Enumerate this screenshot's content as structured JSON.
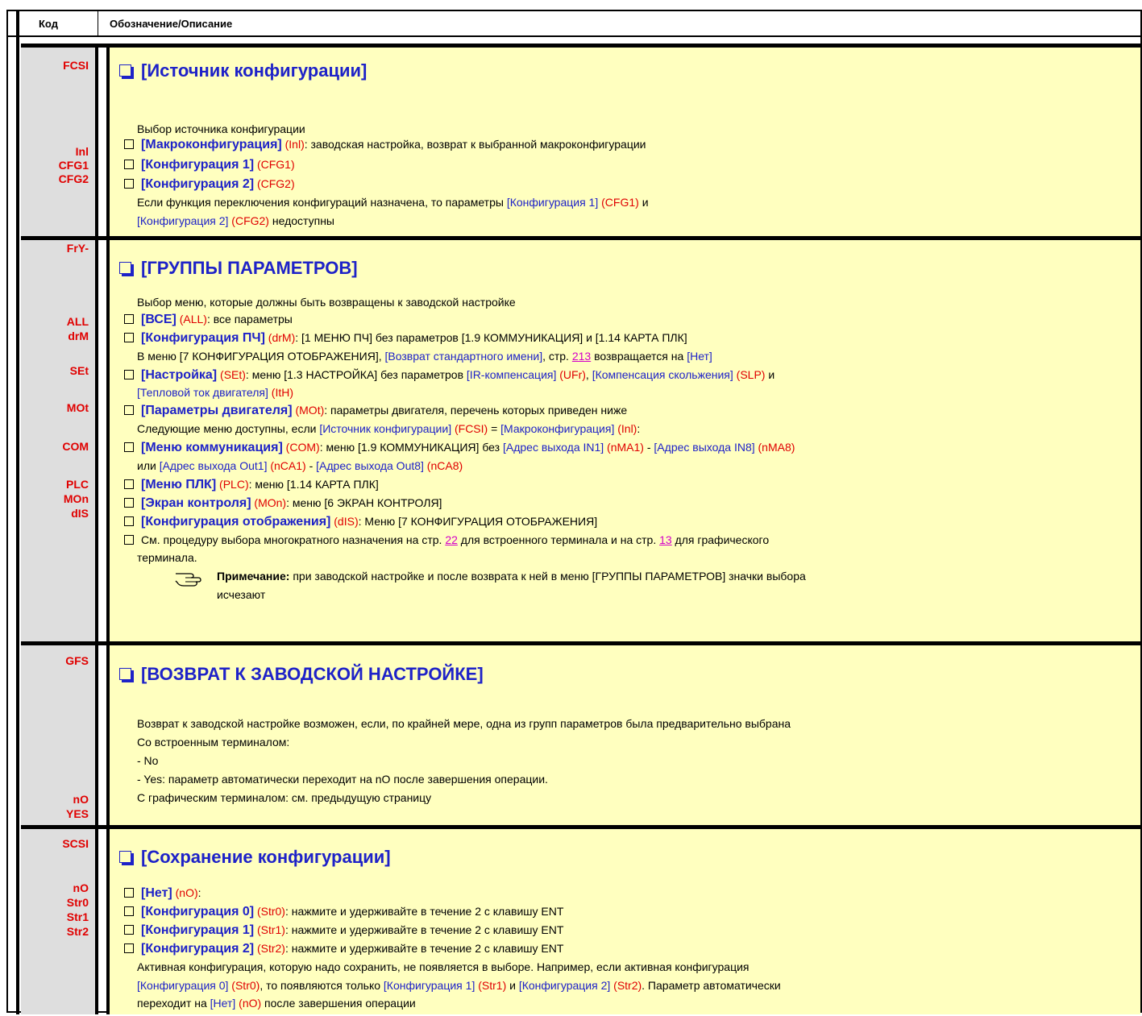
{
  "header": {
    "code": "Код",
    "desc": "Обозначение/Описание"
  },
  "fcsi": {
    "code": "FCSI",
    "codes": [
      "Inl",
      "CFG1",
      "CFG2"
    ],
    "title": "[Источник конфигурации]",
    "intro": "Выбор источника конфигурации",
    "o1": {
      "label": "[Макроконфигурация]",
      "code": " (Inl)",
      "rest": ": заводская настройка, возврат к выбранной макроконфигурации"
    },
    "o2": {
      "label": "[Конфигурация 1]",
      "code": " (CFG1)"
    },
    "o3": {
      "label": "[Конфигурация 2]",
      "code": " (CFG2)"
    },
    "note1": {
      "t1": "Если функция переключения конфигураций назначена, то параметры ",
      "n1": "[Конфигурация 1]",
      "c1": " (CFG1)",
      "t2": " и"
    },
    "note2": {
      "n1": "[Конфигурация 2]",
      "c1": " (CFG2)",
      "t2": " недоступны"
    }
  },
  "fry": {
    "code": "FrY-",
    "codes": [
      "ALL",
      "drM",
      "SEt",
      "MOt",
      "COM",
      "PLC",
      "MOn",
      "dIS"
    ],
    "title": "[ГРУППЫ ПАРАМЕТРОВ]",
    "intro": "Выбор меню, которые должны быть возвращены к заводской настройке",
    "all": {
      "label": "[ВСЕ]",
      "code": " (ALL)",
      "rest": ": все параметры"
    },
    "drm": {
      "label": "[Конфигурация ПЧ]",
      "code": " (drM)",
      "rest": ": [1 МЕНЮ ПЧ] без параметров [1.9 КОММУНИКАЦИЯ] и [1.14 КАРТА ПЛК]"
    },
    "drm2": {
      "t1": "В меню [7 КОНФИГУРАЦИЯ ОТОБРАЖЕНИЯ], ",
      "n1": "[Возврат стандартного имени]",
      "t2": ", стр. ",
      "link": "213",
      "t3": " возвращается на ",
      "n2": "[Нет]"
    },
    "set": {
      "label": "[Настройка]",
      "code": " (SEt)",
      "t1": ": меню [1.3 НАСТРОЙКА] без параметров ",
      "n1": "[IR-компенсация]",
      "c1": " (UFr)",
      "t2": ", ",
      "n2": "[Компенсация скольжения]",
      "c2": " (SLP)",
      "t3": " и"
    },
    "set2": {
      "n1": "[Тепловой ток двигателя]",
      "c1": " (ItH)"
    },
    "mot": {
      "label": "[Параметры двигателя]",
      "code": " (MOt)",
      "rest": ": параметры двигателя, перечень которых приведен ниже"
    },
    "avail": {
      "t1": "Следующие меню доступны, если ",
      "n1": "[Источник конфигурации]",
      "c1": " (FCSI)",
      "t2": " = ",
      "n2": "[Макроконфигурация]",
      "c2": " (Inl)",
      "t3": ":"
    },
    "com": {
      "label": "[Меню коммуникация]",
      "code": " (COM)",
      "t1": ": меню [1.9 КОММУНИКАЦИЯ] без ",
      "n1": "[Адрес выхода  IN1]",
      "c1": " (nMA1)",
      "t2": " - ",
      "n2": "[Адрес выхода  IN8]",
      "c2": " (nMA8)"
    },
    "com2": {
      "t1": "или ",
      "n1": "[Адрес выхода Out1]",
      "c1": " (nCA1)",
      "t2": " - ",
      "n2": "[Адрес выхода Out8]",
      "c2": " (nCA8)"
    },
    "plc": {
      "label": "[Меню ПЛК]",
      "code": " (PLC)",
      "rest": ": меню [1.14 КАРТА ПЛК]"
    },
    "mon": {
      "label": "[Экран контроля]",
      "code": " (MOn)",
      "rest": ": меню [6 ЭКРАН КОНТРОЛЯ]"
    },
    "dis": {
      "label": "[Конфигурация отображения]",
      "code": " (dIS)",
      "rest": ": Меню [7 КОНФИГУРАЦИЯ ОТОБРАЖЕНИЯ]"
    },
    "multi": {
      "t1": "См. процедуру выбора многократного назначения на стр. ",
      "link1": "22",
      "t2": " для встроенного терминала и на стр. ",
      "link2": "13",
      "t3": " для графического"
    },
    "multi2": "терминала.",
    "note": {
      "bold": "Примечание:",
      "rest": " при заводской настройке и  после возврата к ней в меню [ГРУППЫ ПАРАМЕТРОВ] значки выбора",
      "rest2": "исчезают"
    }
  },
  "gfs": {
    "code": "GFS",
    "codes": [
      "nO",
      "YES"
    ],
    "title": "[ВОЗВРАТ К ЗАВОДСКОЙ НАСТРОЙКЕ]",
    "lines": [
      "Возврат к заводской настройке возможен, если, по крайней мере, одна из групп параметров была предварительно выбрана",
      "Со встроенным терминалом:",
      "- No",
      "- Yes: параметр автоматически переходит на nO после завершения операции.",
      "С графическим терминалом: см. предыдущую страницу"
    ]
  },
  "scsi": {
    "code": "SCSI",
    "codes": [
      "nO",
      "Str0",
      "Str1",
      "Str2"
    ],
    "title": "[Сохранение конфигурации]",
    "o1": {
      "label": "[Нет]",
      "code": " (nO)",
      "rest": ":"
    },
    "o2": {
      "label": "[Конфигурация 0]",
      "code": " (Str0)",
      "rest": ": нажмите и удерживайте в течение 2 с клавишу ENT"
    },
    "o3": {
      "label": "[Конфигурация 1]",
      "code": " (Str1)",
      "rest": ": нажмите и удерживайте в течение 2 с клавишу ENT"
    },
    "o4": {
      "label": "[Конфигурация 2]",
      "code": " (Str2)",
      "rest": ": нажмите и удерживайте в течение 2 с клавишу ENT"
    },
    "p1": "Активная конфигурация, которую надо сохранить, не появляется в выборе. Например, если активная конфигурация",
    "p2": {
      "n1": "[Конфигурация 0]",
      "c1": " (Str0)",
      "t1": ", то появляются только ",
      "n2": "[Конфигурация 1]",
      "c2": " (Str1)",
      "t2": " и ",
      "n3": "[Конфигурация 2]",
      "c3": " (Str2)",
      "t3": ". Параметр автоматически"
    },
    "p3": {
      "t1": "переходит на  ",
      "n1": "[Нет]",
      "c1": " (nO)",
      "t2": " после завершения операции"
    }
  }
}
